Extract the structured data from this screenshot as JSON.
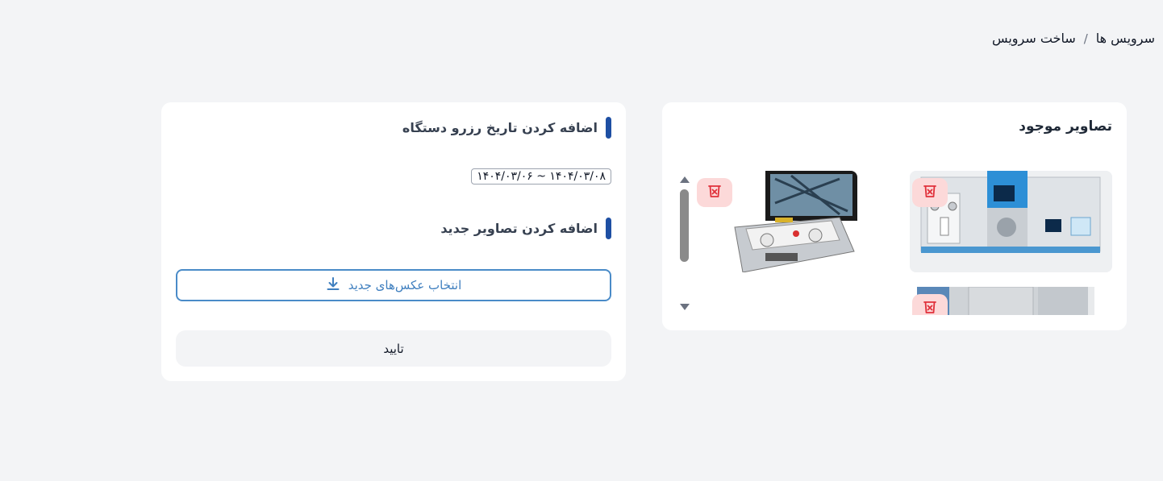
{
  "breadcrumb": {
    "items": [
      "سرویس ها",
      "ساخت سرویس"
    ],
    "separator": "/"
  },
  "reservation": {
    "title": "اضافه کردن تاریخ رزرو دستگاه",
    "date_range": "۱۴۰۴/۰۳/۰۶ ~ ۱۴۰۴/۰۳/۰۸"
  },
  "images": {
    "title": "اضافه کردن تصاویر جدید",
    "choose_button_label": "انتخاب عکس‌های جدید",
    "choose_button_icon": "download-icon"
  },
  "confirm_button_label": "تایید",
  "existing_images": {
    "title": "تصاویر موجود",
    "items": [
      {
        "name": "spectrometer-image",
        "delete_icon": "trash-x-icon"
      },
      {
        "name": "device-case-image",
        "delete_icon": "trash-x-icon"
      },
      {
        "name": "cabinet-image",
        "delete_icon": "trash-x-icon"
      }
    ]
  },
  "colors": {
    "accent": "#1e4fa3",
    "button_border": "#4a8bc8",
    "delete_bg": "#fcd9d9",
    "delete_icon": "#e0303a"
  }
}
